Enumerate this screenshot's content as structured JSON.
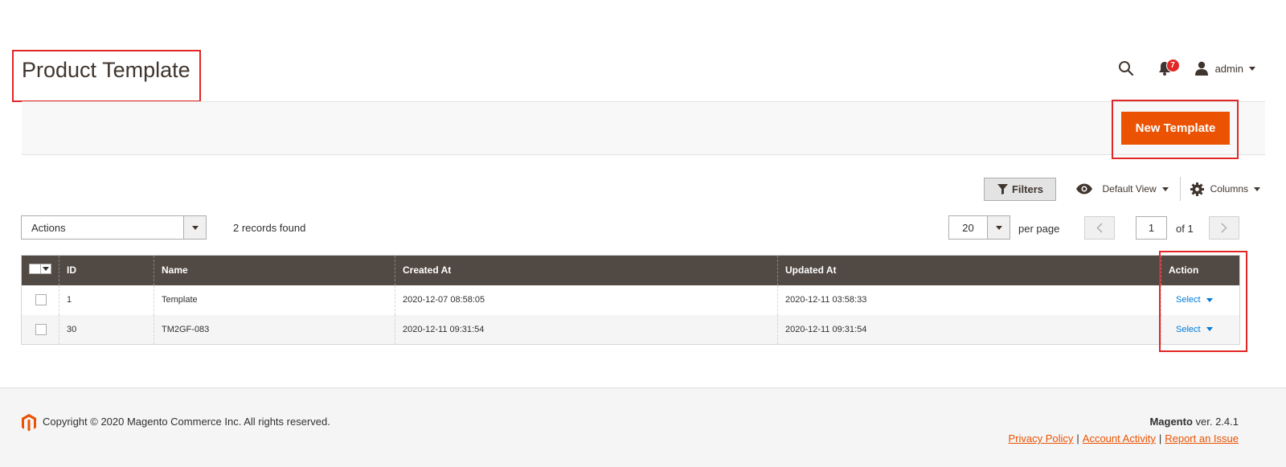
{
  "header": {
    "page_title": "Product Template",
    "notifications_count": "7",
    "user_name": "admin"
  },
  "page_actions": {
    "new_button": "New Template"
  },
  "grid_controls": {
    "filters_label": "Filters",
    "view_label": "Default View",
    "columns_label": "Columns",
    "mass_action_label": "Actions",
    "records_found": "2 records found",
    "per_page_value": "20",
    "per_page_label": "per page",
    "current_page": "1",
    "total_pages_label": "of 1"
  },
  "table": {
    "columns": [
      "ID",
      "Name",
      "Created At",
      "Updated At",
      "Action"
    ],
    "rows": [
      {
        "id": "1",
        "name": "Template",
        "created_at": "2020-12-07 08:58:05",
        "updated_at": "2020-12-11 03:58:33",
        "action": "Select"
      },
      {
        "id": "30",
        "name": "TM2GF-083",
        "created_at": "2020-12-11 09:31:54",
        "updated_at": "2020-12-11 09:31:54",
        "action": "Select"
      }
    ]
  },
  "footer": {
    "copyright": "Copyright © 2020 Magento Commerce Inc. All rights reserved.",
    "brand": "Magento",
    "version": " ver. 2.4.1",
    "links": [
      "Privacy Policy",
      "Account Activity",
      "Report an Issue"
    ]
  },
  "colors": {
    "accent": "#eb5202",
    "grid_header": "#514943",
    "highlight": "#e22626",
    "link": "#007bdb"
  }
}
